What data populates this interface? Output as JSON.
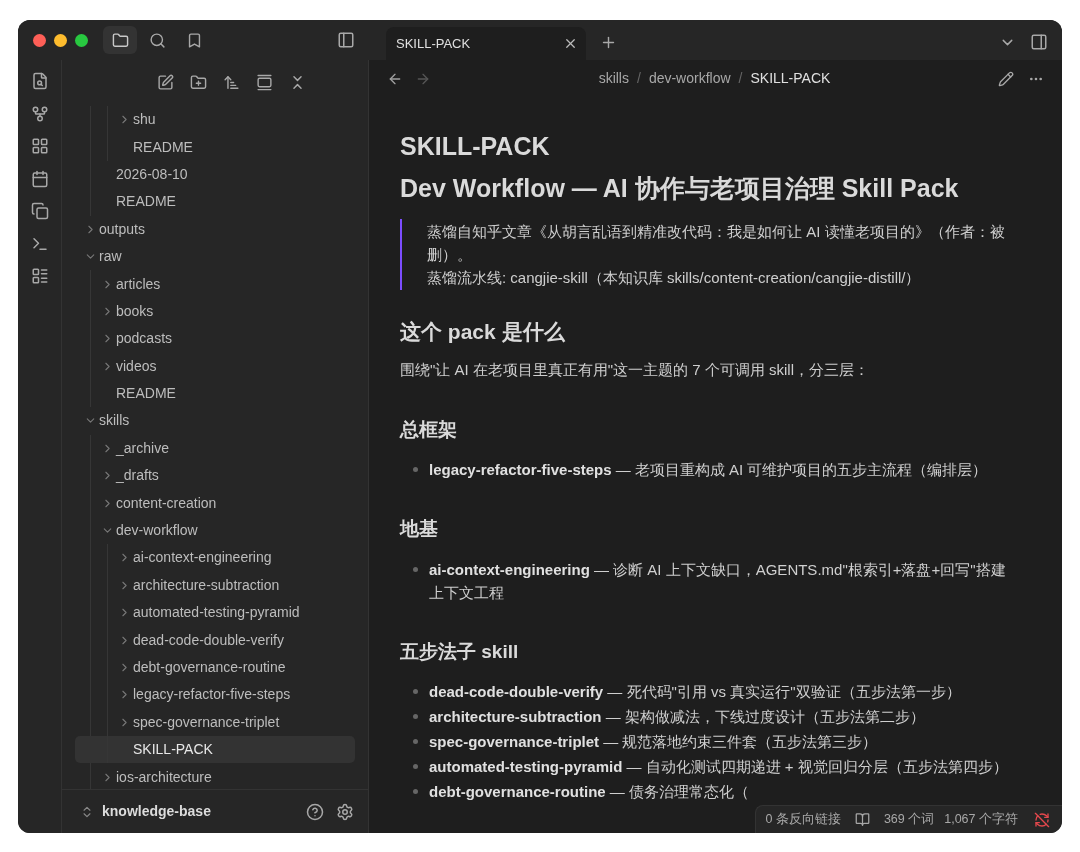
{
  "tab": {
    "title": "SKILL-PACK",
    "selected": true
  },
  "navigation": {
    "back_disabled": false,
    "forward_disabled": true
  },
  "breadcrumb": [
    {
      "kind": "crumb",
      "label": "skills",
      "current": false
    },
    {
      "kind": "separator",
      "label": "/"
    },
    {
      "kind": "crumb",
      "label": "dev-workflow",
      "current": false
    },
    {
      "kind": "separator",
      "label": "/"
    },
    {
      "kind": "crumb",
      "label": "SKILL-PACK",
      "current": true
    }
  ],
  "sidebar": {
    "tree": [
      {
        "children": [
          {
            "children": [
              {
                "label": "shu",
                "kind": "folder",
                "expanded": false,
                "selected": false
              },
              {
                "label": "README",
                "kind": "file",
                "selected": false
              }
            ]
          },
          {
            "label": "2026-08-10",
            "kind": "file",
            "selected": false
          },
          {
            "label": "README",
            "kind": "file",
            "selected": false
          }
        ]
      },
      {
        "label": "outputs",
        "kind": "folder",
        "expanded": false,
        "selected": false
      },
      {
        "label": "raw",
        "kind": "folder",
        "expanded": true,
        "selected": false,
        "children": [
          {
            "label": "articles",
            "kind": "folder",
            "expanded": false,
            "selected": false
          },
          {
            "label": "books",
            "kind": "folder",
            "expanded": false,
            "selected": false
          },
          {
            "label": "podcasts",
            "kind": "folder",
            "expanded": false,
            "selected": false
          },
          {
            "label": "videos",
            "kind": "folder",
            "expanded": false,
            "selected": false
          },
          {
            "label": "README",
            "kind": "file",
            "selected": false
          }
        ]
      },
      {
        "label": "skills",
        "kind": "folder",
        "expanded": true,
        "selected": false,
        "children": [
          {
            "label": "_archive",
            "kind": "folder",
            "expanded": false,
            "selected": false
          },
          {
            "label": "_drafts",
            "kind": "folder",
            "expanded": false,
            "selected": false
          },
          {
            "label": "content-creation",
            "kind": "folder",
            "expanded": false,
            "selected": false
          },
          {
            "label": "dev-workflow",
            "kind": "folder",
            "expanded": true,
            "selected": false,
            "children": [
              {
                "label": "ai-context-engineering",
                "kind": "folder",
                "expanded": false,
                "selected": false
              },
              {
                "label": "architecture-subtraction",
                "kind": "folder",
                "expanded": false,
                "selected": false
              },
              {
                "label": "automated-testing-pyramid",
                "kind": "folder",
                "expanded": false,
                "selected": false
              },
              {
                "label": "dead-code-double-verify",
                "kind": "folder",
                "expanded": false,
                "selected": false
              },
              {
                "label": "debt-governance-routine",
                "kind": "folder",
                "expanded": false,
                "selected": false
              },
              {
                "label": "legacy-refactor-five-steps",
                "kind": "folder",
                "expanded": false,
                "selected": false
              },
              {
                "label": "spec-governance-triplet",
                "kind": "folder",
                "expanded": false,
                "selected": false
              },
              {
                "label": "SKILL-PACK",
                "kind": "file",
                "selected": true
              }
            ]
          },
          {
            "label": "ios-architecture",
            "kind": "folder",
            "expanded": false,
            "selected": false
          }
        ]
      }
    ],
    "vault": "knowledge-base"
  },
  "document": {
    "blocks": [
      {
        "kind": "h1",
        "text": "SKILL-PACK"
      },
      {
        "kind": "h1",
        "text": "Dev Workflow — AI 协作与老项目治理 Skill Pack"
      },
      {
        "kind": "quote",
        "lines": [
          "蒸馏自知乎文章《从胡言乱语到精准改代码：我是如何让 AI 读懂老项目的》（作者：被删）。",
          "蒸馏流水线: cangjie-skill（本知识库 skills/content-creation/cangjie-distill/）"
        ]
      },
      {
        "kind": "h2",
        "text": "这个 pack 是什么"
      },
      {
        "kind": "p",
        "text": "围绕\"让 AI 在老项目里真正有用\"这一主题的 7 个可调用 skill，分三层："
      },
      {
        "kind": "h3",
        "text": "总框架"
      },
      {
        "kind": "list",
        "items": [
          "**legacy-refactor-five-steps** — 老项目重构成 AI 可维护项目的五步主流程（编排层）"
        ]
      },
      {
        "kind": "h3",
        "text": "地基"
      },
      {
        "kind": "list",
        "items": [
          "**ai-context-engineering** — 诊断 AI 上下文缺口，AGENTS.md\"根索引+落盘+回写\"搭建上下文工程"
        ]
      },
      {
        "kind": "h3",
        "text": "五步法子 skill"
      },
      {
        "kind": "list",
        "items": [
          "**dead-code-double-verify** — 死代码\"引用 vs 真实运行\"双验证（五步法第一步）",
          "**architecture-subtraction** — 架构做减法，下线过度设计（五步法第二步）",
          "**spec-governance-triplet** — 规范落地约束三件套（五步法第三步）",
          "**automated-testing-pyramid** — 自动化测试四期递进 + 视觉回归分层（五步法第四步）",
          "**debt-governance-routine** — 债务治理常态化（"
        ]
      }
    ]
  },
  "status_bar": {
    "backlinks": "0 条反向链接",
    "words": "369 个词",
    "characters": "1,067 个字符",
    "sync_error": true
  }
}
